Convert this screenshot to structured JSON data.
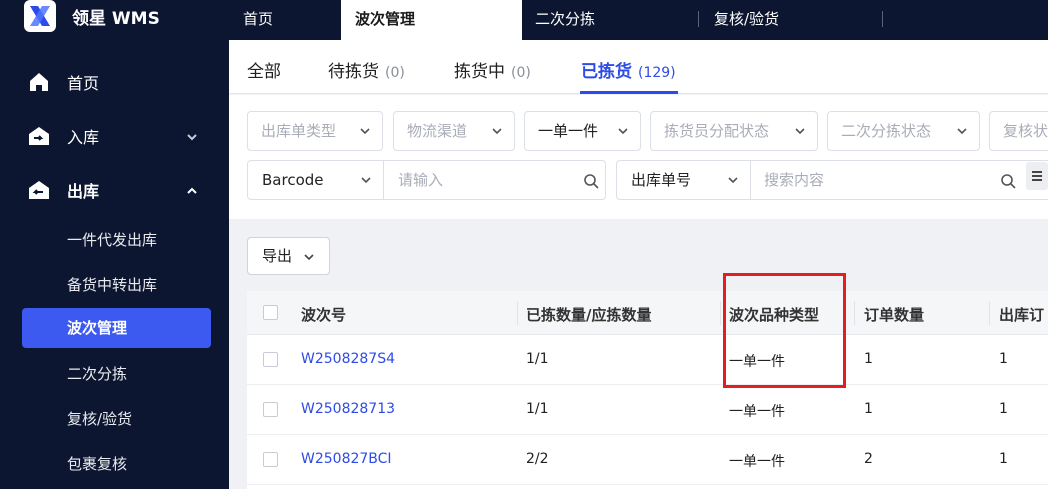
{
  "app": {
    "brand": "领星 WMS"
  },
  "top_tabs": [
    {
      "label": "首页",
      "active": false
    },
    {
      "label": "波次管理",
      "active": true
    },
    {
      "label": "二次分拣",
      "active": false
    },
    {
      "label": "复核/验货",
      "active": false
    }
  ],
  "sidebar": {
    "items": [
      {
        "label": "首页",
        "icon": "home-icon"
      },
      {
        "label": "入库",
        "icon": "inbound-icon",
        "expanded": false
      },
      {
        "label": "出库",
        "icon": "outbound-icon",
        "expanded": true
      }
    ],
    "sub_items": [
      {
        "label": "一件代发出库",
        "active": false
      },
      {
        "label": "备货中转出库",
        "active": false
      },
      {
        "label": "波次管理",
        "active": true
      },
      {
        "label": "二次分拣",
        "active": false
      },
      {
        "label": "复核/验货",
        "active": false
      },
      {
        "label": "包裹复核",
        "active": false
      }
    ]
  },
  "status_tabs": [
    {
      "label": "全部",
      "count": ""
    },
    {
      "label": "待拣货",
      "count": "(0)"
    },
    {
      "label": "拣货中",
      "count": "(0)"
    },
    {
      "label": "已拣货",
      "count": "(129)",
      "active": true
    }
  ],
  "filters": {
    "row1": [
      {
        "label": "出库单类型",
        "selected": false
      },
      {
        "label": "物流渠道",
        "selected": false
      },
      {
        "label": "一单一件",
        "selected": true
      },
      {
        "label": "拣货员分配状态",
        "selected": false
      },
      {
        "label": "二次分拣状态",
        "selected": false
      },
      {
        "label": "复核状",
        "selected": false
      }
    ],
    "search1": {
      "type": "Barcode",
      "placeholder": "请输入"
    },
    "search2": {
      "type": "出库单号",
      "placeholder": "搜索内容"
    }
  },
  "toolbar": {
    "export_label": "导出"
  },
  "table": {
    "columns": [
      "波次号",
      "已拣数量/应拣数量",
      "波次品种类型",
      "订单数量",
      "出库订"
    ],
    "rows": [
      {
        "wave_no": "W2508287S4",
        "picked": "1/1",
        "variety_type": "一单一件",
        "order_count": "1",
        "outbound": "1"
      },
      {
        "wave_no": "W250828713",
        "picked": "1/1",
        "variety_type": "一单一件",
        "order_count": "1",
        "outbound": "1"
      },
      {
        "wave_no": "W250827BCI",
        "picked": "2/2",
        "variety_type": "一单一件",
        "order_count": "2",
        "outbound": "1"
      }
    ]
  },
  "colors": {
    "accent": "#2d4be8",
    "nav_bg": "#0d1630",
    "highlight": "#e41e1e"
  }
}
